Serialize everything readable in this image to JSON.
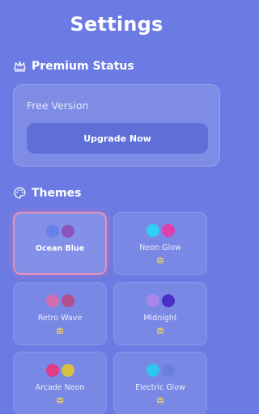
{
  "header": {
    "title": "Settings"
  },
  "premium": {
    "section_title": "Premium Status",
    "status_text": "Free Version",
    "upgrade_label": "Upgrade Now"
  },
  "themes": {
    "section_title": "Themes",
    "items": [
      {
        "name": "Ocean Blue",
        "colors": [
          "#6b7fe8",
          "#8a54b8"
        ],
        "selected": true,
        "locked": false
      },
      {
        "name": "Neon Glow",
        "colors": [
          "#2ed0f5",
          "#e03fae"
        ],
        "selected": false,
        "locked": true
      },
      {
        "name": "Retro Wave",
        "colors": [
          "#d46eb3",
          "#b24f8f"
        ],
        "selected": false,
        "locked": true
      },
      {
        "name": "Midnight",
        "colors": [
          "#a987ea",
          "#4b2fc4"
        ],
        "selected": false,
        "locked": true
      },
      {
        "name": "Arcade Neon",
        "colors": [
          "#e23a85",
          "#d8c040"
        ],
        "selected": false,
        "locked": true
      },
      {
        "name": "Electric Glow",
        "colors": [
          "#2cc6ef",
          "#6a7fd9"
        ],
        "selected": false,
        "locked": true
      }
    ]
  },
  "colors": {
    "background": "#6b7be3",
    "selected_border": "#e88fb6",
    "crown": "#f3d35a"
  }
}
